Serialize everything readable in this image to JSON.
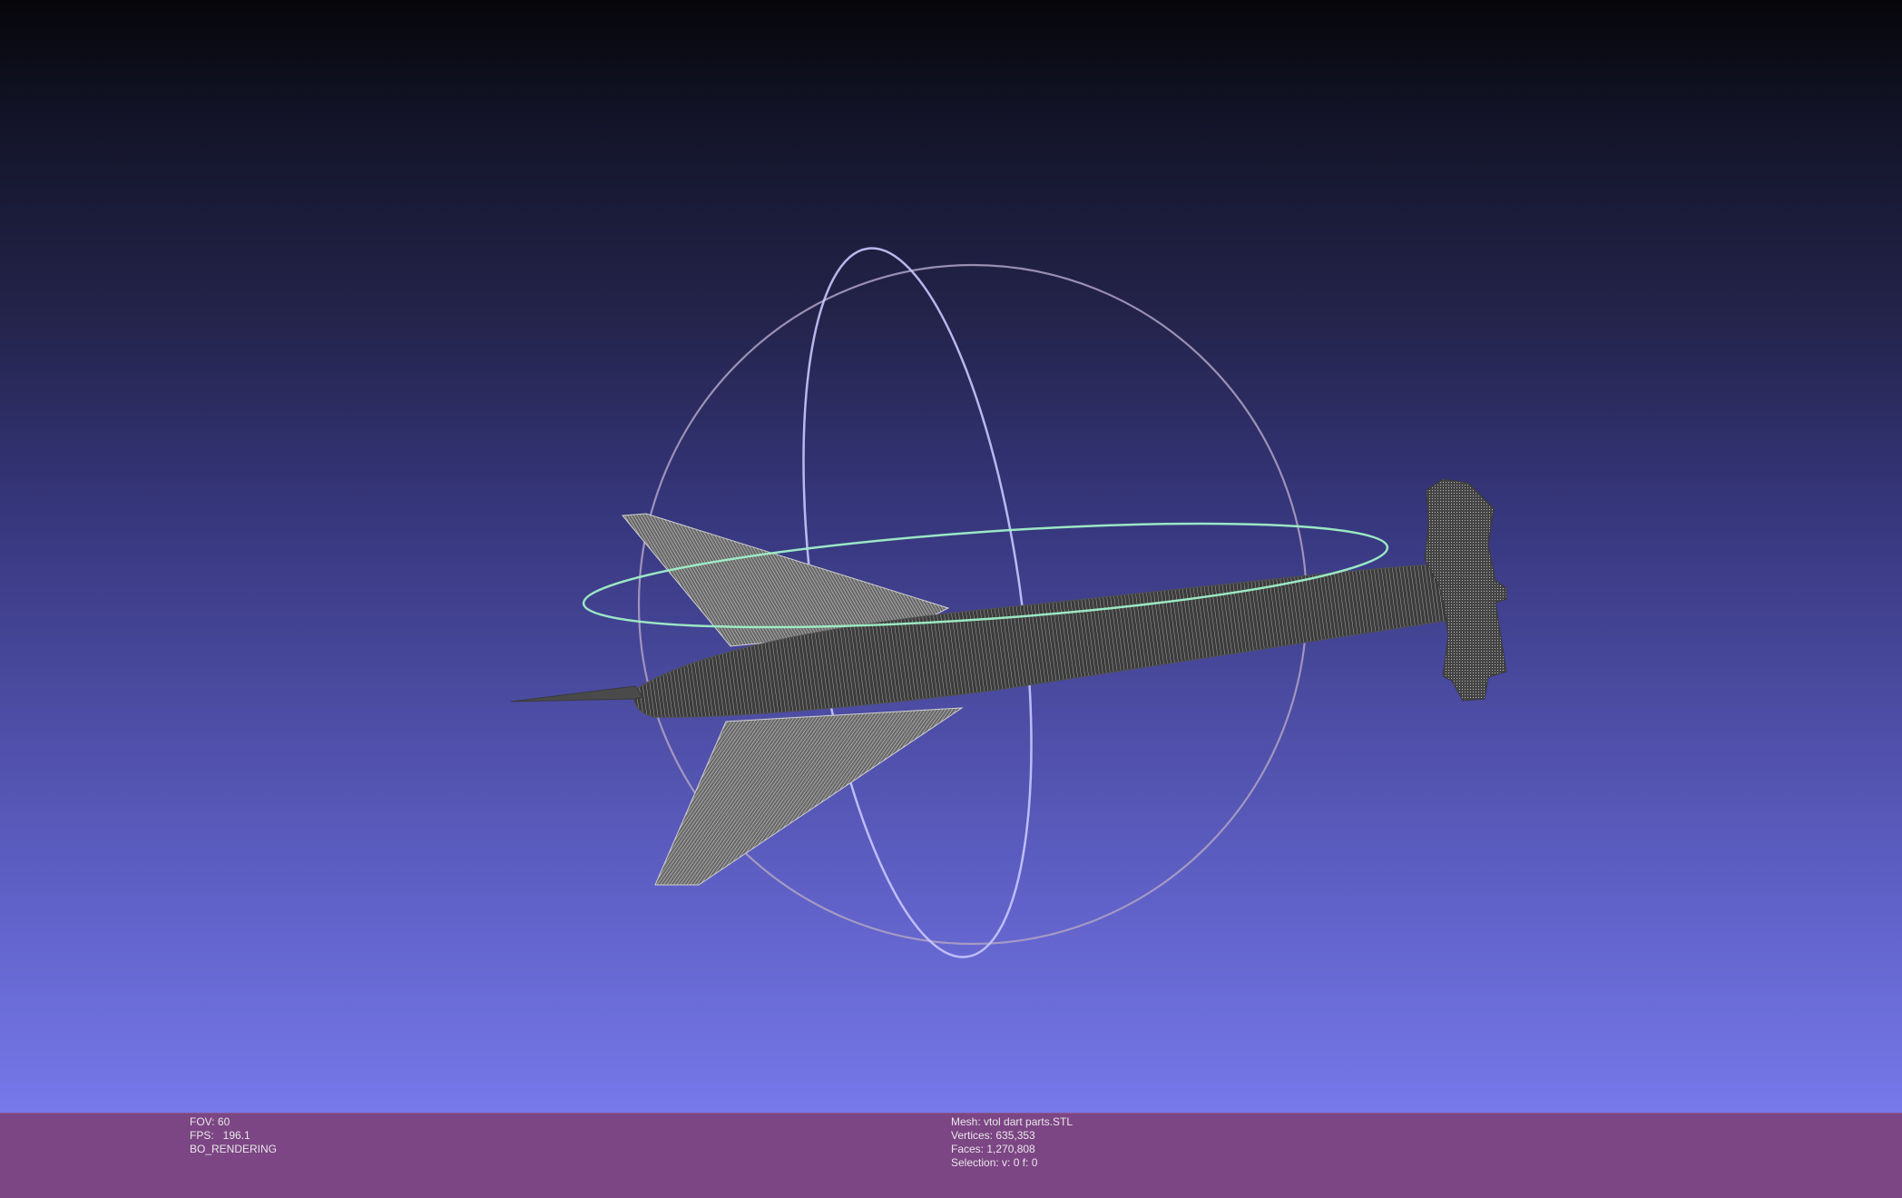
{
  "viewer": {
    "background_top": "#06060a",
    "background_bottom": "#7778ea",
    "info_bar_color": "#7c4584"
  },
  "render_info": {
    "fov_label": "FOV: 60",
    "fps_label": "FPS:   196.1",
    "mode_label": "BO_RENDERING"
  },
  "mesh_info": {
    "mesh_label": "Mesh: vtol dart parts.STL",
    "vertices_label": "Vertices: 635,353",
    "faces_label": "Faces: 1,270,808",
    "selection_label": "Selection: v: 0 f: 0"
  },
  "trackball": {
    "ring_colors": [
      "#b4a8c8",
      "#c8c8ff",
      "#9ff0c8"
    ]
  },
  "model": {
    "name": "vtol dart parts.STL",
    "wire_color": "#e6e6e6",
    "body_color": "#4a4a4a"
  }
}
